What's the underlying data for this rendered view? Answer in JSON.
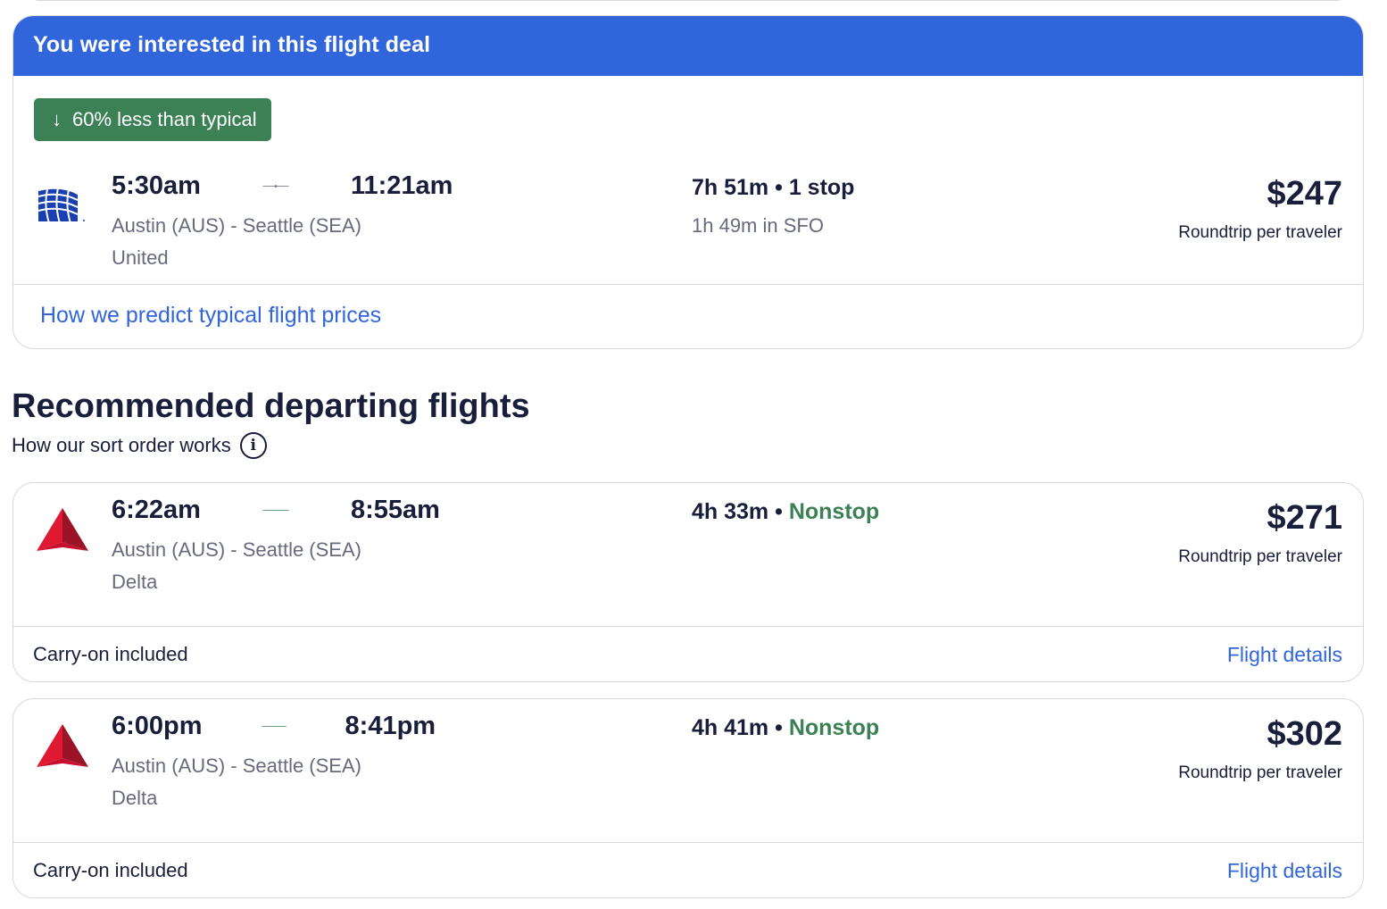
{
  "deal": {
    "banner": "You were interested in this flight deal",
    "badge_icon": "arrow-down-icon",
    "badge_text": "60% less than typical",
    "depart": "5:30am",
    "arrive": "11:21am",
    "route": "Austin (AUS) - Seattle (SEA)",
    "airline": "United",
    "duration": "7h 51m",
    "stops": "1 stop",
    "layover": "1h 49m in SFO",
    "price": "$247",
    "price_sub": "Roundtrip per traveler",
    "link": "How we predict typical flight prices"
  },
  "recommended": {
    "title": "Recommended departing flights",
    "sort_link": "How our sort order works",
    "flights": [
      {
        "depart": "6:22am",
        "arrive": "8:55am",
        "route": "Austin (AUS) - Seattle (SEA)",
        "airline": "Delta",
        "duration": "4h 33m",
        "stops": "Nonstop",
        "price": "$271",
        "price_sub": "Roundtrip per traveler",
        "carry_on": "Carry-on included",
        "details": "Flight details"
      },
      {
        "depart": "6:00pm",
        "arrive": "8:41pm",
        "route": "Austin (AUS) - Seattle (SEA)",
        "airline": "Delta",
        "duration": "4h 41m",
        "stops": "Nonstop",
        "price": "$302",
        "price_sub": "Roundtrip per traveler",
        "carry_on": "Carry-on included",
        "details": "Flight details"
      }
    ]
  },
  "colors": {
    "banner_blue": "#3165db",
    "badge_green": "#3b8155",
    "nonstop_green": "#3b8155",
    "text_dark": "#191e3b",
    "text_muted": "#676a7d",
    "link_blue": "#3165db",
    "united_blue": "#1a3fb0",
    "delta_red": "#c8102e"
  }
}
